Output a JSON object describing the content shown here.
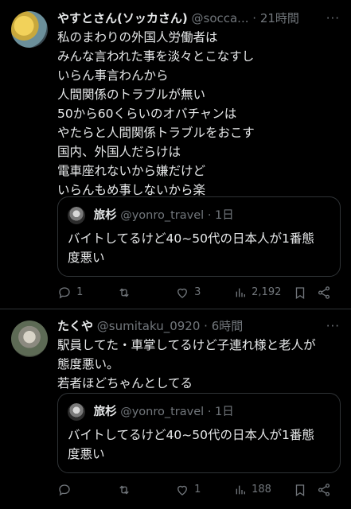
{
  "tweets": [
    {
      "author_name": "やすとさん(ソッカさん)",
      "handle": "@socca...",
      "separator": "·",
      "time": "21時間",
      "more": "···",
      "lines": [
        "私のまわりの外国人労働者は",
        "みんな言われた事を淡々とこなすし",
        "いらん事言わんから",
        "人間関係のトラブルが無い",
        "50から60くらいのオバチャンは",
        "やたらと人間関係トラブルをおこす",
        "国内、外国人だらけは",
        "電車座れないから嫌だけど",
        "いらんもめ事しないから楽"
      ],
      "quote": {
        "name": "旅杉",
        "handle": "@yonro_travel",
        "separator": "·",
        "time": "1日",
        "lines": [
          "バイトしてるけど40~50代の日本人が1番態",
          "度悪い"
        ]
      },
      "actions": {
        "replies": "1",
        "retweets": "",
        "likes": "3",
        "views": "2,192"
      }
    },
    {
      "author_name": "たくや",
      "handle": "@sumitaku_0920",
      "separator": "·",
      "time": "6時間",
      "more": "···",
      "lines": [
        "駅員してた・車掌してるけど子連れ様と老人が",
        "態度悪い。",
        "若者ほどちゃんとしてる"
      ],
      "quote": {
        "name": "旅杉",
        "handle": "@yonro_travel",
        "separator": "·",
        "time": "1日",
        "lines": [
          "バイトしてるけど40~50代の日本人が1番態",
          "度悪い"
        ]
      },
      "actions": {
        "replies": "",
        "retweets": "",
        "likes": "1",
        "views": "188"
      }
    }
  ],
  "icons": {
    "reply": "reply-icon",
    "retweet": "retweet-icon",
    "like": "heart-icon",
    "views": "views-icon",
    "bookmark": "bookmark-icon",
    "share": "share-icon"
  },
  "colors": {
    "background": "#000000",
    "text": "#e7e9ea",
    "muted": "#71767b",
    "border": "#2f3336"
  }
}
